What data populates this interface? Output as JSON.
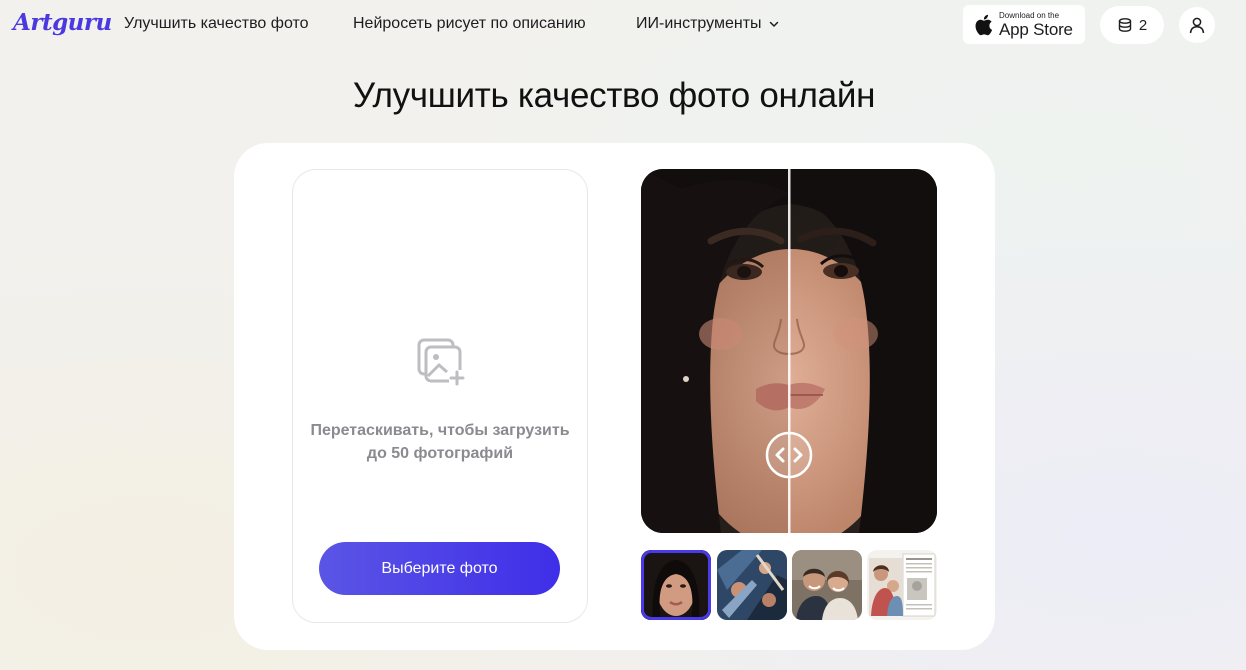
{
  "header": {
    "logo": "Artguru",
    "nav": [
      {
        "label": "Улучшить качество фото"
      },
      {
        "label": "Нейросеть рисует по описанию"
      },
      {
        "label": "ИИ-инструменты"
      }
    ],
    "appstore": {
      "small": "Download on the",
      "big": "App Store"
    },
    "credits": "2"
  },
  "main": {
    "title": "Улучшить качество фото онлайн",
    "upload": {
      "text_line1": "Перетаскивать, чтобы загрузить",
      "text_line2": "до 50 фотографий",
      "button": "Выберите фото"
    },
    "preview": {
      "slider_fraction": 0.5
    },
    "thumbnails": [
      {
        "name": "portrait-girl",
        "active": true
      },
      {
        "name": "crowd-blue",
        "active": false
      },
      {
        "name": "couple-smiling",
        "active": false
      },
      {
        "name": "mother-child-newspaper",
        "active": false
      }
    ]
  },
  "colors": {
    "accent": "#4a39e0",
    "button_start": "#5b55e6",
    "button_end": "#3f2ee8"
  }
}
